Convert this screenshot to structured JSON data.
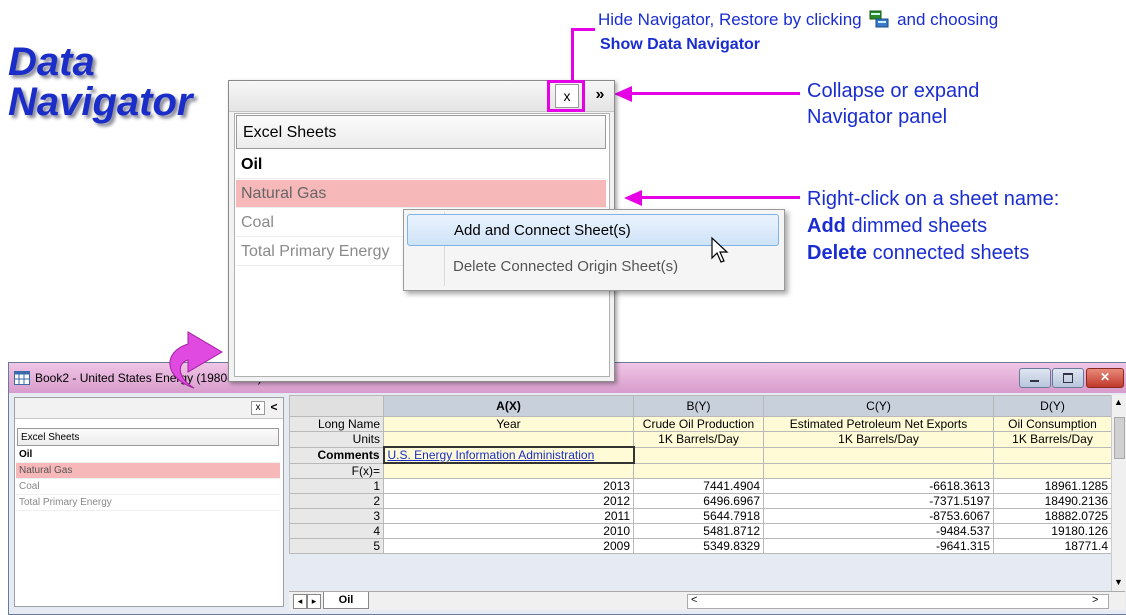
{
  "heading": {
    "line1": "Data",
    "line2": "Navigator"
  },
  "annotations": {
    "hide_line1_a": "Hide Navigator, Restore by clicking",
    "hide_line1_b": "and choosing",
    "hide_line2": "Show Data Navigator",
    "collapse_line1": "Collapse or expand",
    "collapse_line2": "Navigator panel",
    "rightclick_line1": "Right-click on a sheet name:",
    "rightclick_add_bold": "Add",
    "rightclick_add_rest": " dimmed sheets",
    "rightclick_del_bold": "Delete",
    "rightclick_del_rest": " connected sheets"
  },
  "navigator": {
    "close_label": "x",
    "expand_label": "»",
    "panel_header": "Excel Sheets",
    "sheets": [
      {
        "label": "Oil",
        "state": "active"
      },
      {
        "label": "Natural Gas",
        "state": "selected"
      },
      {
        "label": "Coal",
        "state": "dimmed"
      },
      {
        "label": "Total Primary Energy",
        "state": "dimmed"
      }
    ]
  },
  "context_menu": {
    "items": [
      "Add and Connect Sheet(s)",
      "Delete Connected Origin Sheet(s)"
    ]
  },
  "book": {
    "title": "Book2 - United States Energy (1980-2013).xls",
    "side_close": "x",
    "side_collapse": "<",
    "side_header": "Excel Sheets",
    "side_sheets": [
      "Oil",
      "Natural Gas",
      "Coal",
      "Total Primary Energy"
    ],
    "columns": [
      "A(X)",
      "B(Y)",
      "C(Y)",
      "D(Y)"
    ],
    "label_rows": [
      {
        "label": "Long Name",
        "cells": [
          "Year",
          "Crude Oil Production",
          "Estimated Petroleum Net Exports",
          "Oil Consumption"
        ]
      },
      {
        "label": "Units",
        "cells": [
          "",
          "1K Barrels/Day",
          "1K Barrels/Day",
          "1K Barrels/Day"
        ]
      },
      {
        "label": "Comments",
        "cells": [
          "U.S. Energy Information Administration",
          "",
          "",
          ""
        ]
      },
      {
        "label": "F(x)=",
        "cells": [
          "",
          "",
          "",
          ""
        ]
      }
    ],
    "data_rows": [
      {
        "row": "1",
        "cells": [
          "2013",
          "7441.4904",
          "-6618.3613",
          "18961.1285"
        ]
      },
      {
        "row": "2",
        "cells": [
          "2012",
          "6496.6967",
          "-7371.5197",
          "18490.2136"
        ]
      },
      {
        "row": "3",
        "cells": [
          "2011",
          "5644.7918",
          "-8753.6067",
          "18882.0725"
        ]
      },
      {
        "row": "4",
        "cells": [
          "2010",
          "5481.8712",
          "-9484.537",
          "19180.126"
        ]
      },
      {
        "row": "5",
        "cells": [
          "2009",
          "5349.8329",
          "-9641.315",
          "18771.4"
        ]
      }
    ],
    "sheet_tab": "Oil",
    "hscroll_left": "<",
    "hscroll_right": ">"
  },
  "colors": {
    "accent": "#1a2dc8",
    "magenta": "#e600e6",
    "selected_row": "#f6b8b8"
  }
}
